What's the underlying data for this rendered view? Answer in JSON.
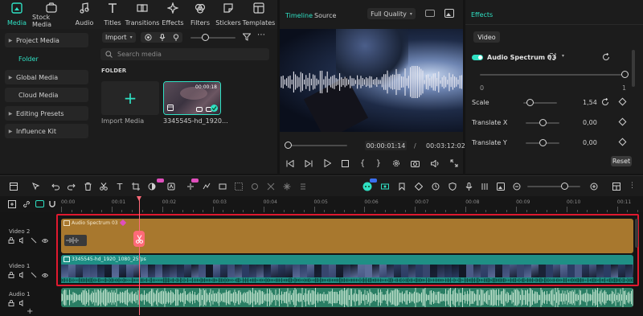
{
  "top_tabs": [
    {
      "label": "Media",
      "icon": "media-icon",
      "active": true
    },
    {
      "label": "Stock Media",
      "icon": "stock-media-icon"
    },
    {
      "label": "Audio",
      "icon": "music-note-icon"
    },
    {
      "label": "Titles",
      "icon": "titles-icon"
    },
    {
      "label": "Transitions",
      "icon": "transitions-icon"
    },
    {
      "label": "Effects",
      "icon": "effects-icon"
    },
    {
      "label": "Filters",
      "icon": "filters-icon"
    },
    {
      "label": "Stickers",
      "icon": "stickers-icon"
    },
    {
      "label": "Templates",
      "icon": "templates-icon"
    }
  ],
  "left_nav": [
    {
      "label": "Project Media",
      "expandable": true
    },
    {
      "label": "Folder",
      "selected": true
    },
    {
      "label": "Global Media",
      "expandable": true
    },
    {
      "label": "Cloud Media"
    },
    {
      "label": "Editing Presets",
      "expandable": true
    },
    {
      "label": "Influence Kit",
      "expandable": true
    }
  ],
  "media": {
    "import_label": "Import",
    "search_placeholder": "Search media",
    "folder_heading": "FOLDER",
    "import_tile_label": "Import Media",
    "clip": {
      "name": "3345545-hd_1920...",
      "duration": "00:00:18"
    }
  },
  "preview": {
    "tab_timeline": "Timeline",
    "tab_source": "Source",
    "quality": "Full Quality",
    "current_time": "00:00:01:14",
    "separator": "/",
    "total_time": "00:03:12:02",
    "progress": 0.01
  },
  "effects": {
    "panel_title": "Effects",
    "tab_video": "Video",
    "effect_name": "Audio Spectrum 03",
    "slider_min": "0",
    "slider_max": "1",
    "slider_value": 1.0,
    "params": [
      {
        "label": "Scale",
        "value": "1,54",
        "level": 0.2
      },
      {
        "label": "Translate X",
        "value": "0,00",
        "level": 0.5
      },
      {
        "label": "Translate Y",
        "value": "0,00",
        "level": 0.5
      }
    ],
    "reset_label": "Reset"
  },
  "timeline": {
    "ruler": [
      "00:00",
      "00:01",
      "00:02",
      "00:03",
      "00:04",
      "00:05",
      "00:06",
      "00:07",
      "00:08",
      "00:09",
      "00:10",
      "00:11"
    ],
    "zoom_level": 0.7,
    "tracks": [
      {
        "label": "Video 2",
        "clip": "Audio Spectrum 03"
      },
      {
        "label": "Video 1",
        "clip": "3345545-hd_1920_1080_25fps"
      },
      {
        "label": "Audio 1"
      }
    ]
  },
  "colors": {
    "accent": "#2fe0c3",
    "effect_clip": "#a8782e",
    "video_clip": "#1f8f85",
    "audio_clip": "#2a7e64",
    "selection": "#e0192f",
    "playhead": "#ff6a78"
  }
}
